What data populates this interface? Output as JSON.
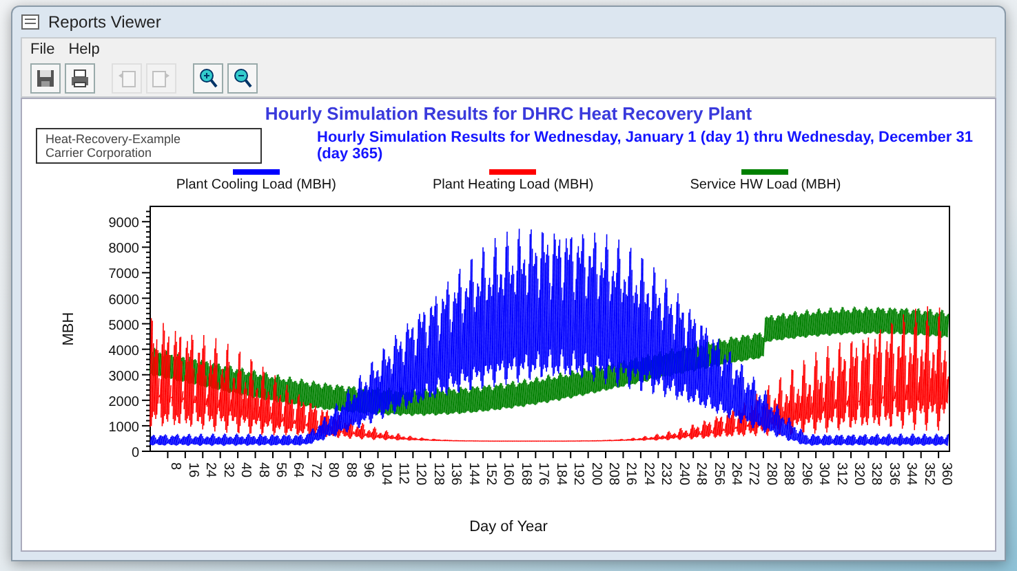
{
  "window": {
    "title": "Reports Viewer"
  },
  "menu": [
    {
      "label": "File"
    },
    {
      "label": "Help"
    }
  ],
  "toolbar": [
    {
      "kind": "save",
      "disabled": false
    },
    {
      "kind": "print",
      "disabled": false
    },
    {
      "kind": "prev-page",
      "disabled": true
    },
    {
      "kind": "next-page",
      "disabled": true
    },
    {
      "kind": "zoom-in",
      "disabled": false
    },
    {
      "kind": "zoom-out",
      "disabled": false
    }
  ],
  "report": {
    "title": "Hourly Simulation Results for DHRC Heat Recovery Plant",
    "header_lines": [
      "Heat-Recovery-Example",
      "Carrier Corporation"
    ],
    "subtitle": "Hourly Simulation Results for Wednesday, January 1 (day 1) thru Wednesday, December 31 (day 365)",
    "legend": [
      {
        "label": "Plant Cooling Load (MBH)",
        "color": "#0000ff"
      },
      {
        "label": "Plant Heating Load (MBH)",
        "color": "#ff0000"
      },
      {
        "label": "Service HW Load (MBH)",
        "color": "#008000"
      }
    ],
    "chart": {
      "ylabel": "MBH",
      "xlabel": "Day of Year",
      "yticks": [
        "9000",
        "8000",
        "7000",
        "6000",
        "5000",
        "4000",
        "3000",
        "2000",
        "1000",
        "0"
      ],
      "xticks": [
        "8",
        "16",
        "24",
        "32",
        "40",
        "48",
        "56",
        "64",
        "72",
        "80",
        "88",
        "96",
        "104",
        "112",
        "120",
        "128",
        "136",
        "144",
        "152",
        "160",
        "168",
        "176",
        "184",
        "192",
        "200",
        "208",
        "216",
        "224",
        "232",
        "240",
        "248",
        "256",
        "264",
        "272",
        "280",
        "288",
        "296",
        "304",
        "312",
        "320",
        "328",
        "336",
        "344",
        "352",
        "360"
      ]
    }
  }
}
